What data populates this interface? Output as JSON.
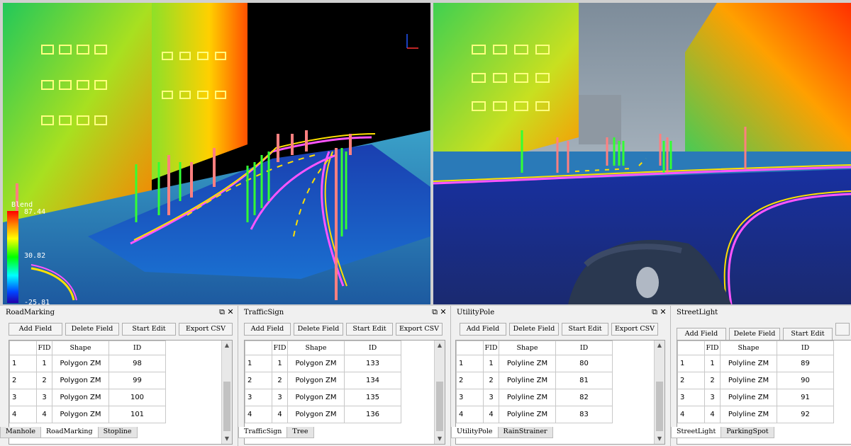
{
  "legend": {
    "title": "Blend",
    "max": "87.44",
    "mid": "30.82",
    "min": "-25.81"
  },
  "ui": {
    "restore_icon": "⧉",
    "close_icon": "✕",
    "up_arrow": "▲",
    "down_arrow": "▼"
  },
  "colors": {
    "lane_line": "#ffd400",
    "curb": "#ff4dff",
    "pole": "#ff7f7f",
    "tree_trunk": "#44ff44",
    "ground": "#1436a8"
  },
  "panels": [
    {
      "title": "RoadMarking",
      "buttons": [
        "Add Field",
        "Delete  Field",
        "Start Edit",
        "Export CSV"
      ],
      "headers": [
        "",
        "FID",
        "Shape",
        "ID"
      ],
      "rows": [
        [
          "1",
          "1",
          "Polygon ZM",
          "98"
        ],
        [
          "2",
          "2",
          "Polygon ZM",
          "99"
        ],
        [
          "3",
          "3",
          "Polygon ZM",
          "100"
        ],
        [
          "4",
          "4",
          "Polygon ZM",
          "101"
        ]
      ],
      "tabs": [
        "Manhole",
        "RoadMarking",
        "Stopline"
      ],
      "active_tab": 1
    },
    {
      "title": "TrafficSign",
      "buttons": [
        "Add Field",
        "Delete  Field",
        "Start Edit",
        "Export CSV"
      ],
      "headers": [
        "",
        "FID",
        "Shape",
        "ID"
      ],
      "rows": [
        [
          "1",
          "1",
          "Polygon ZM",
          "133"
        ],
        [
          "2",
          "2",
          "Polygon ZM",
          "134"
        ],
        [
          "3",
          "3",
          "Polygon ZM",
          "135"
        ],
        [
          "4",
          "4",
          "Polygon ZM",
          "136"
        ]
      ],
      "tabs": [
        "TrafficSign",
        "Tree"
      ],
      "active_tab": 0
    },
    {
      "title": "UtilityPole",
      "buttons": [
        "Add Field",
        "Delete  Field",
        "Start Edit",
        "Export CSV"
      ],
      "headers": [
        "",
        "FID",
        "Shape",
        "ID"
      ],
      "rows": [
        [
          "1",
          "1",
          "Polyline ZM",
          "80"
        ],
        [
          "2",
          "2",
          "Polyline ZM",
          "81"
        ],
        [
          "3",
          "3",
          "Polyline ZM",
          "82"
        ],
        [
          "4",
          "4",
          "Polyline ZM",
          "83"
        ]
      ],
      "tabs": [
        "UtilityPole",
        "RainStrainer"
      ],
      "active_tab": 0
    },
    {
      "title": "StreetLight",
      "buttons": [
        "Add Field",
        "Delete  Field",
        "Start Edit"
      ],
      "headers": [
        "",
        "FID",
        "Shape",
        "ID"
      ],
      "rows": [
        [
          "1",
          "1",
          "Polyline ZM",
          "89"
        ],
        [
          "2",
          "2",
          "Polyline ZM",
          "90"
        ],
        [
          "3",
          "3",
          "Polyline ZM",
          "91"
        ],
        [
          "4",
          "4",
          "Polyline ZM",
          "92"
        ]
      ],
      "tabs": [
        "StreetLight",
        "ParkingSpot"
      ],
      "active_tab": 0
    }
  ]
}
